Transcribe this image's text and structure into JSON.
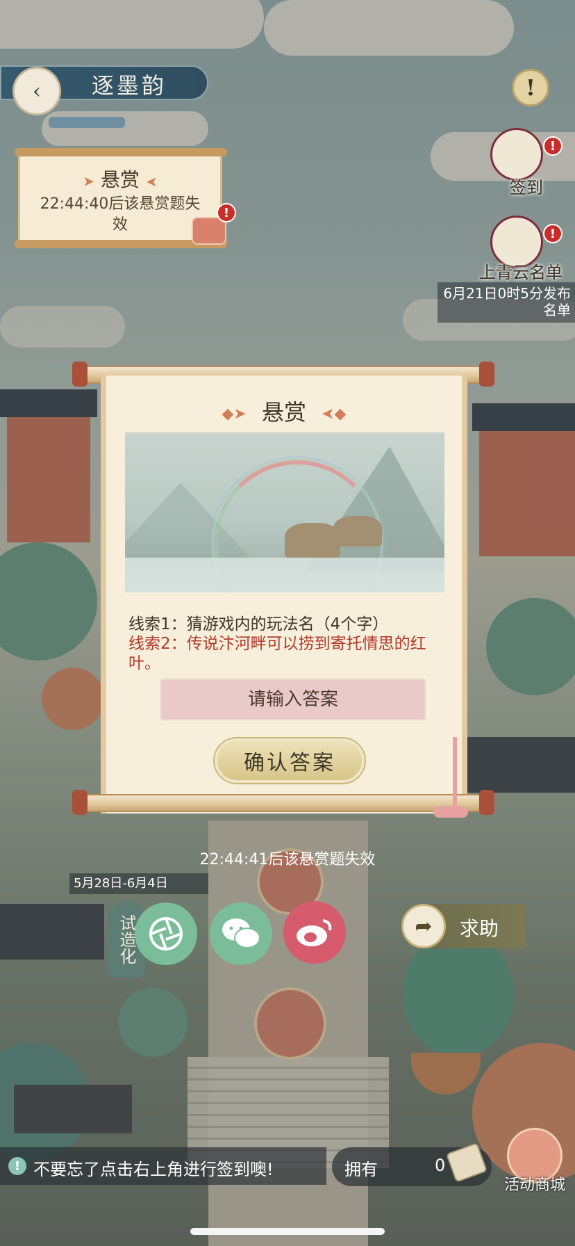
{
  "header": {
    "title": "逐墨韵",
    "back_glyph": "‹",
    "info_glyph": "!"
  },
  "mini_bounty": {
    "title": "悬赏",
    "countdown": "22:44:40后该悬赏题失效",
    "badge": "!"
  },
  "side": {
    "checkin_label": "签到",
    "checkin_badge": "!",
    "rank_label": "上青云名单",
    "rank_badge": "!",
    "release_note": "6月21日0时5分发布名单"
  },
  "modal": {
    "title": "悬赏",
    "clue1": "线索1：猜游戏内的玩法名（4个字）",
    "clue2": "线索2：传说汴河畔可以捞到寄托情思的红叶。",
    "answer_placeholder": "请输入答案",
    "answer_value": "",
    "confirm_label": "确认答案"
  },
  "footer": {
    "countdown": "22:44:41后该悬赏题失效",
    "date_range": "5月28日-6月4日",
    "try_tag": "试造化",
    "help_label": "求助",
    "notice": "不要忘了点击右上角进行签到噢!",
    "own_label": "拥有",
    "own_count": "0",
    "shop_label": "活动商城"
  },
  "icons": {
    "moments": "camera-aperture-icon",
    "wechat": "wechat-icon",
    "weibo": "weibo-icon",
    "help": "share-arrow-icon"
  },
  "colors": {
    "accent_red": "#b23b2c",
    "wechat_green": "#7bbd9a",
    "weibo_red": "#d65b6d",
    "scroll_paper": "#f7eedb"
  }
}
